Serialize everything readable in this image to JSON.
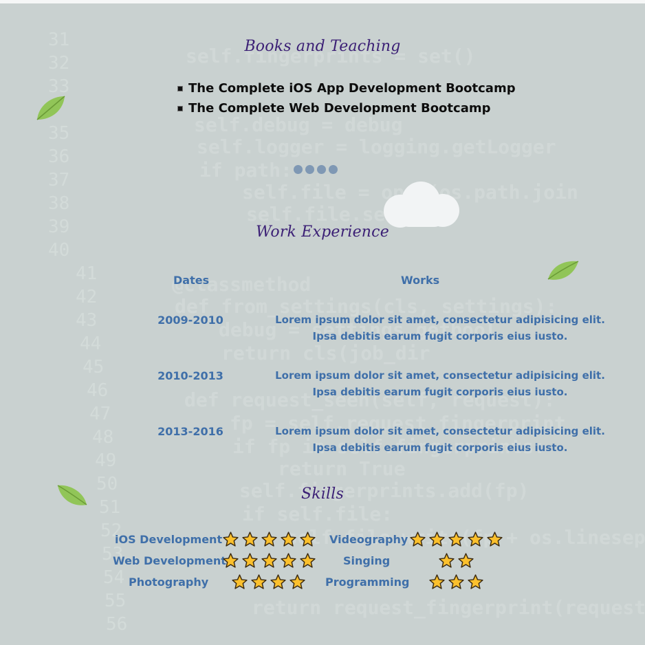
{
  "books_section": {
    "title": "Books and Teaching",
    "items": [
      "The Complete iOS App Development Bootcamp",
      "The Complete Web Development Bootcamp"
    ]
  },
  "work_section": {
    "title": "Work Experience",
    "columns": [
      "Dates",
      "Works"
    ],
    "rows": [
      {
        "dates": "2009-2010",
        "work_line1": "Lorem ipsum dolor sit amet, consectetur adipisicing elit.",
        "work_line2": "Ipsa debitis earum fugit corporis eius iusto."
      },
      {
        "dates": "2010-2013",
        "work_line1": "Lorem ipsum dolor sit amet, consectetur adipisicing elit.",
        "work_line2": "Ipsa debitis earum fugit corporis eius iusto."
      },
      {
        "dates": "2013-2016",
        "work_line1": "Lorem ipsum dolor sit amet, consectetur adipisicing elit.",
        "work_line2": "Ipsa debitis earum fugit corporis eius iusto."
      }
    ]
  },
  "skills_section": {
    "title": "Skills",
    "skills": [
      {
        "name": "iOS Development",
        "stars": 5
      },
      {
        "name": "Videography",
        "stars": 5
      },
      {
        "name": "Web Development",
        "stars": 5
      },
      {
        "name": "Singing",
        "stars": 2
      },
      {
        "name": "Photography",
        "stars": 4
      },
      {
        "name": "Programming",
        "stars": 3
      }
    ]
  },
  "icons": {
    "star": "star-icon",
    "leaf": "leaf-icon",
    "cloud": "cloud-icon",
    "dots": "dots-divider"
  },
  "colors": {
    "heading": "#3b1f75",
    "accent": "#3f6fa9",
    "star_fill": "#fbc02d",
    "leaf": "#8bc34a"
  }
}
